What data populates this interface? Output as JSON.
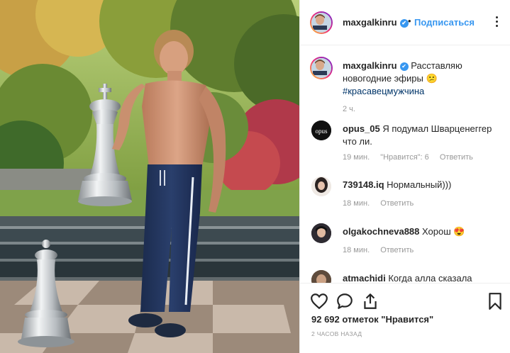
{
  "post": {
    "photo_alt": "post-photo"
  },
  "header": {
    "username": "maxgalkinru",
    "separator": "•",
    "follow_label": "Подписаться"
  },
  "caption": {
    "username": "maxgalkinru",
    "text": "Расставляю новогодние эфиры",
    "emoji": "😕",
    "hashtag": "#красавецмужчина",
    "time": "2 ч."
  },
  "comments": [
    {
      "username": "opus_05",
      "text": "Я подумал Шварценеггер что ли.",
      "time": "19 мин.",
      "likes": "\"Нравится\": 6",
      "reply": "Ответить"
    },
    {
      "username": "739148.iq",
      "text": "Нормальный)))",
      "time": "18 мин.",
      "reply": "Ответить"
    },
    {
      "username": "olgakochneva888",
      "text": "Хорош",
      "emoji": "😍",
      "time": "18 мин.",
      "reply": "Ответить"
    },
    {
      "username": "atmachidi",
      "text": "Когда алла сказала"
    }
  ],
  "footer": {
    "likes": "92 692 отметок \"Нравится\"",
    "posted_ago": "2 ЧАСОВ НАЗАД"
  },
  "colors": {
    "accent": "#3897f0",
    "text": "#262626",
    "muted": "#999999",
    "hashtag": "#003569"
  },
  "icons": [
    "verified-icon",
    "more-options-icon",
    "heart-icon",
    "comment-icon",
    "share-icon",
    "bookmark-icon"
  ]
}
